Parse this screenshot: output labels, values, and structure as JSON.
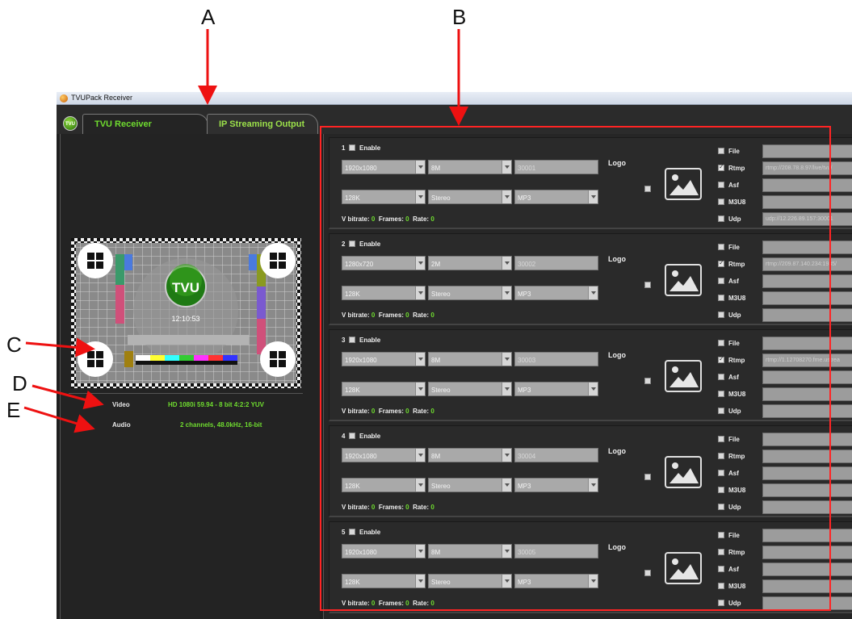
{
  "annotations": {
    "a": "A",
    "b": "B",
    "c": "C",
    "d": "D",
    "e": "E"
  },
  "window": {
    "title": "TVUPack Receiver"
  },
  "tabs": [
    {
      "label": "TVU Receiver",
      "logo": "TVU",
      "active": false
    },
    {
      "label": "IP Streaming Output",
      "active": true
    }
  ],
  "preview": {
    "logo_text": "TVU",
    "timecode": "12:10:53"
  },
  "signal": {
    "video_label": "Video",
    "video_value": "HD 1080i 59.94 - 8 bit 4:2:2 YUV",
    "audio_label": "Audio",
    "audio_value": "2 channels, 48.0kHz, 16-bit"
  },
  "common": {
    "enable_label": "Enable",
    "logo_label": "Logo",
    "vbitrate_label": "V bitrate:",
    "frames_label": "Frames:",
    "rate_label": "Rate:",
    "outputs": [
      "File",
      "Rtmp",
      "Asf",
      "M3U8",
      "Udp"
    ]
  },
  "streams": [
    {
      "num": "1",
      "resolution": "1920x1080",
      "bitrate": "8M",
      "port": "30001",
      "audio_rate": "128K",
      "channels": "Stereo",
      "codec": "MP3",
      "vbitrate": "0",
      "frames": "0",
      "rate": "0",
      "rtmp_checked": true,
      "rtmp_url": "rtmp://208.78.8.97/live/tvu/",
      "udp_url": "udp://12.226.89.157:30001"
    },
    {
      "num": "2",
      "resolution": "1280x720",
      "bitrate": "2M",
      "port": "30002",
      "audio_rate": "128K",
      "channels": "Stereo",
      "codec": "MP3",
      "vbitrate": "0",
      "frames": "0",
      "rate": "0",
      "rtmp_checked": true,
      "rtmp_url": "rtmp://209.87.140.234:1935/",
      "udp_url": ""
    },
    {
      "num": "3",
      "resolution": "1920x1080",
      "bitrate": "8M",
      "port": "30003",
      "audio_rate": "128K",
      "channels": "Stereo",
      "codec": "MP3",
      "vbitrate": "0",
      "frames": "0",
      "rate": "0",
      "rtmp_checked": true,
      "rtmp_url": "rtmp://1.12708270.fme.ustrea",
      "udp_url": ""
    },
    {
      "num": "4",
      "resolution": "1920x1080",
      "bitrate": "8M",
      "port": "30004",
      "audio_rate": "128K",
      "channels": "Stereo",
      "codec": "MP3",
      "vbitrate": "0",
      "frames": "0",
      "rate": "0",
      "rtmp_checked": false,
      "rtmp_url": "",
      "udp_url": ""
    },
    {
      "num": "5",
      "resolution": "1920x1080",
      "bitrate": "8M",
      "port": "30005",
      "audio_rate": "128K",
      "channels": "Stereo",
      "codec": "MP3",
      "vbitrate": "0",
      "frames": "0",
      "rate": "0",
      "rtmp_checked": false,
      "rtmp_url": "",
      "udp_url": ""
    }
  ],
  "colors": {
    "accent_green": "#6fdc2f",
    "highlight_red": "#ff2424",
    "panel_bg": "#262626"
  }
}
